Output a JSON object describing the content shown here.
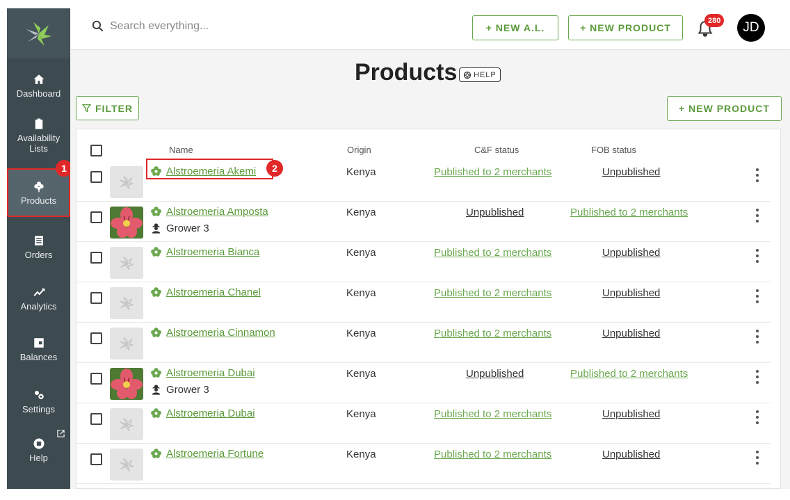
{
  "colors": {
    "accent": "#6aa84f",
    "sidebar": "#3d4a50",
    "callout": "#e02828"
  },
  "sidebar": {
    "items": [
      {
        "label": "Dashboard",
        "icon": "home-icon"
      },
      {
        "label": "Availability Lists",
        "icon": "clipboard-icon"
      },
      {
        "label": "Products",
        "icon": "flower-icon",
        "active": true
      },
      {
        "label": "Orders",
        "icon": "list-icon"
      },
      {
        "label": "Analytics",
        "icon": "trend-icon"
      },
      {
        "label": "Balances",
        "icon": "wallet-icon"
      },
      {
        "label": "Settings",
        "icon": "gears-icon"
      },
      {
        "label": "Help",
        "icon": "lifebuoy-icon",
        "external": true
      }
    ]
  },
  "callouts": {
    "one": "1",
    "two": "2"
  },
  "topbar": {
    "search_placeholder": "Search everything...",
    "new_al_label": "+  NEW A.L.",
    "new_product_label": "+  NEW PRODUCT",
    "notifications_count": "280",
    "avatar_initials": "JD"
  },
  "page": {
    "title": "Products",
    "help_label": "HELP",
    "filter_label": "FILTER",
    "new_product_label": "+  NEW PRODUCT"
  },
  "table": {
    "headers": {
      "name": "Name",
      "origin": "Origin",
      "cf": "C&F status",
      "fob": "FOB status"
    },
    "rows": [
      {
        "name": "Alstroemeria Akemi",
        "grower": "",
        "origin": "Kenya",
        "cf": "Published to 2 merchants",
        "fob": "Unpublished",
        "photo": false
      },
      {
        "name": "Alstroemeria Amposta",
        "grower": "Grower 3",
        "origin": "Kenya",
        "cf": "Unpublished",
        "fob": "Published to 2 merchants",
        "photo": true
      },
      {
        "name": "Alstroemeria Bianca",
        "grower": "",
        "origin": "Kenya",
        "cf": "Published to 2 merchants",
        "fob": "Unpublished",
        "photo": false
      },
      {
        "name": "Alstroemeria Chanel",
        "grower": "",
        "origin": "Kenya",
        "cf": "Published to 2 merchants",
        "fob": "Unpublished",
        "photo": false
      },
      {
        "name": "Alstroemeria Cinnamon",
        "grower": "",
        "origin": "Kenya",
        "cf": "Published to 2 merchants",
        "fob": "Unpublished",
        "photo": false
      },
      {
        "name": "Alstroemeria Dubai",
        "grower": "Grower 3",
        "origin": "Kenya",
        "cf": "Unpublished",
        "fob": "Published to 2 merchants",
        "photo": true
      },
      {
        "name": "Alstroemeria Dubai",
        "grower": "",
        "origin": "Kenya",
        "cf": "Published to 2 merchants",
        "fob": "Unpublished",
        "photo": false
      },
      {
        "name": "Alstroemeria Fortune",
        "grower": "",
        "origin": "Kenya",
        "cf": "Published to 2 merchants",
        "fob": "Unpublished",
        "photo": false
      }
    ]
  }
}
